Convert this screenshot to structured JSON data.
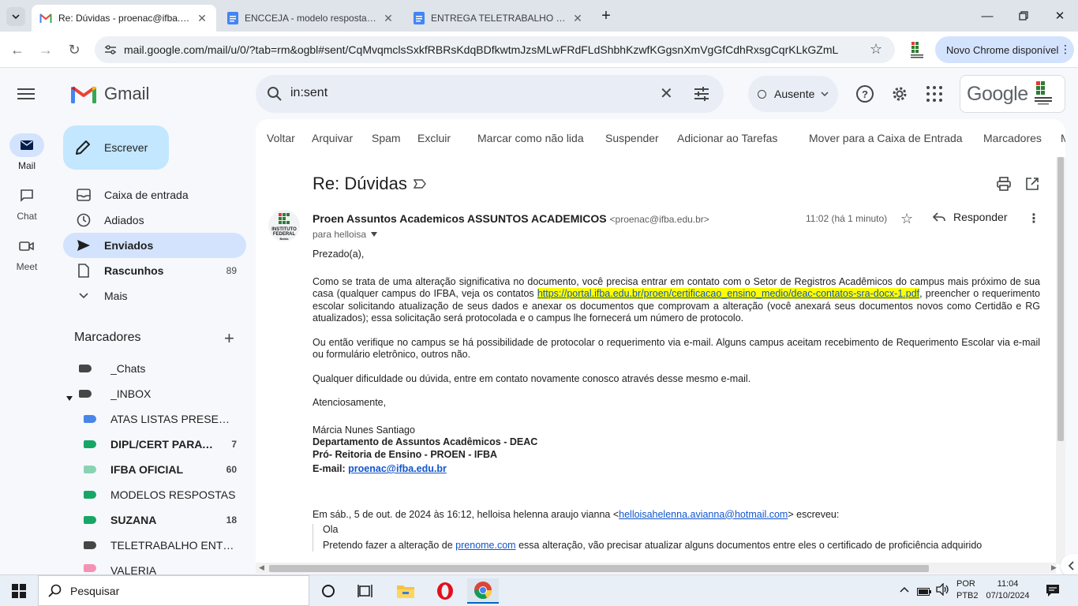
{
  "browser": {
    "tabs": [
      {
        "title": "Re: Dúvidas - proenac@ifba.edu.br",
        "active": true
      },
      {
        "title": "ENCCEJA - modelo respostas - Goo",
        "active": false
      },
      {
        "title": "ENTREGA TELETRABALHO MARÇO",
        "active": false
      }
    ],
    "url": "mail.google.com/mail/u/0/?tab=rm&ogbl#sent/CqMvqmclsSxkfRBRsKdqBDfkwtmJzsMLwFRdFLdShbhKzwfKGgsnXmVgGfCdhRxsgCqrKLkGZmL",
    "new_chrome": "Novo Chrome disponível"
  },
  "rail": {
    "mail": "Mail",
    "chat": "Chat",
    "meet": "Meet"
  },
  "header": {
    "brand": "Gmail",
    "search_value": "in:sent",
    "status": "Ausente",
    "google_logo": "Google"
  },
  "compose": "Escrever",
  "nav": [
    {
      "label": "Caixa de entrada",
      "count": ""
    },
    {
      "label": "Adiados",
      "count": ""
    },
    {
      "label": "Enviados",
      "count": ""
    },
    {
      "label": "Rascunhos",
      "count": "89"
    },
    {
      "label": "Mais",
      "count": ""
    }
  ],
  "labels_header": "Marcadores",
  "labels": [
    {
      "name": "_Chats",
      "count": "",
      "color": "#444746",
      "bold": false
    },
    {
      "name": "_INBOX",
      "count": "",
      "color": "#444746",
      "bold": false
    },
    {
      "name": "ATAS LISTAS PRESENÇ...",
      "count": "",
      "color": "#4a86e8",
      "bold": false
    },
    {
      "name": "DIPL/CERT PARA ...",
      "count": "7",
      "color": "#16a766",
      "bold": true
    },
    {
      "name": "IFBA OFICIAL",
      "count": "60",
      "color": "#89d3b2",
      "bold": true
    },
    {
      "name": "MODELOS RESPOSTAS",
      "count": "",
      "color": "#16a766",
      "bold": false
    },
    {
      "name": "SUZANA",
      "count": "18",
      "color": "#16a766",
      "bold": true
    },
    {
      "name": "TELETRABALHO ENTRE...",
      "count": "",
      "color": "#444746",
      "bold": false
    },
    {
      "name": "VALERIA",
      "count": "",
      "color": "#f691b3",
      "bold": false
    }
  ],
  "actions": [
    "Voltar",
    "Arquivar",
    "Spam",
    "Excluir",
    "Marcar como não lida",
    "Suspender",
    "Adicionar ao Tarefas",
    "Mover para a Caixa de Entrada",
    "Marcadores",
    "M"
  ],
  "email": {
    "subject": "Re: Dúvidas",
    "sender_name": "Proen Assuntos Academicos ASSUNTOS ACADEMICOS",
    "sender_email": "<proenac@ifba.edu.br>",
    "to": "para helloisa",
    "time": "11:02 (há 1 minuto)",
    "reply": "Responder",
    "avatar_text1": "INSTITUTO",
    "avatar_text2": "FEDERAL",
    "avatar_text3": "Bahia",
    "greeting": "Prezado(a),",
    "p1_a": "Como se trata de uma alteração significativa no documento, você precisa entrar em contato com o Setor de Registros Acadêmicos do campus mais próximo de sua casa (qualquer campus do IFBA, veja os contatos ",
    "p1_link": "https://portal.ifba.edu.br/proen/certificacao_ensino_medio/deac-contatos-sra-docx-1.pdf",
    "p1_b": ", preencher o requerimento escolar solicitando atualização de seus dados e  anexar os documentos que comprovam a alteração (você anexará seus documentos novos como Certidão e RG atualizados);  essa solicitação será protocolada e o campus lhe fornecerá um número de protocolo.",
    "p2": "Ou então verifique no campus se há possibilidade de protocolar o requerimento via e-mail. Alguns campus aceitam recebimento de Requerimento Escolar via e-mail ou formulário eletrônico, outros não.",
    "p3": "Qualquer dificuldade ou dúvida, entre em contato novamente conosco através desse mesmo e-mail.",
    "closing": "Atenciosamente,",
    "sig_name": "Márcia Nunes Santiago",
    "sig_dept": "Departamento de Assuntos Acadêmicos - DEAC",
    "sig_dean": "Pró- Reitoria de Ensino - PROEN - IFBA",
    "sig_email_label": "E-mail: ",
    "sig_email": "proenac@ifba.edu.br",
    "quote_head_a": "Em sáb., 5 de out. de 2024 às 16:12, helloisa helenna araujo vianna <",
    "quote_email": "helloisahelenna.avianna@hotmail.com",
    "quote_head_b": "> escreveu:",
    "quote_l1": "Ola",
    "quote_l2_a": "Pretendo  fazer a alteração de ",
    "quote_l2_link": "prenome.com",
    "quote_l2_b": " essa alteração, vão precisar  atualizar  alguns  documentos entre eles o certificado  de proficiência adquirido"
  },
  "taskbar": {
    "search": "Pesquisar",
    "lang1": "POR",
    "lang2": "PTB2",
    "time": "11:04",
    "date": "07/10/2024"
  }
}
